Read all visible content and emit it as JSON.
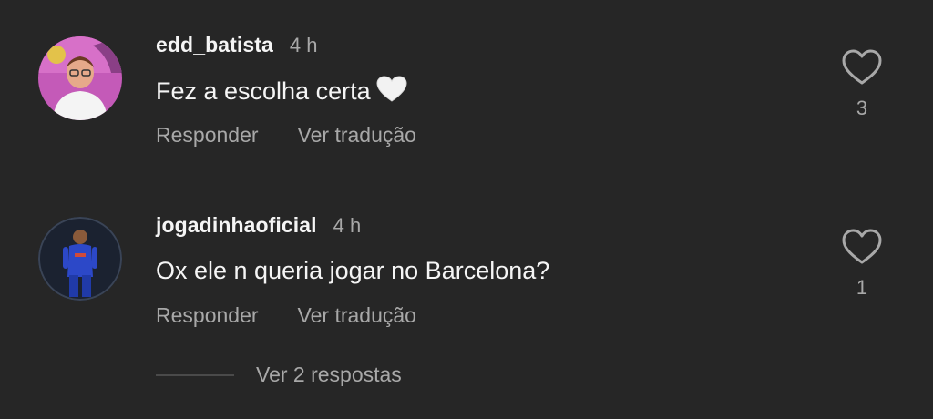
{
  "comments": [
    {
      "username": "edd_batista",
      "time": "4 h",
      "text": "Fez a escolha certa",
      "emoji": "white-heart-emoji",
      "likes": "3",
      "actions": {
        "reply": "Responder",
        "translate": "Ver tradução"
      }
    },
    {
      "username": "jogadinhaoficial",
      "time": "4 h",
      "text": "Ox ele n queria jogar no Barcelona?",
      "likes": "1",
      "actions": {
        "reply": "Responder",
        "translate": "Ver tradução"
      }
    }
  ],
  "replies": {
    "label": "Ver 2 respostas"
  },
  "colors": {
    "background": "#262626",
    "primary_text": "#f5f5f5",
    "secondary_text": "#a8a8a8"
  }
}
